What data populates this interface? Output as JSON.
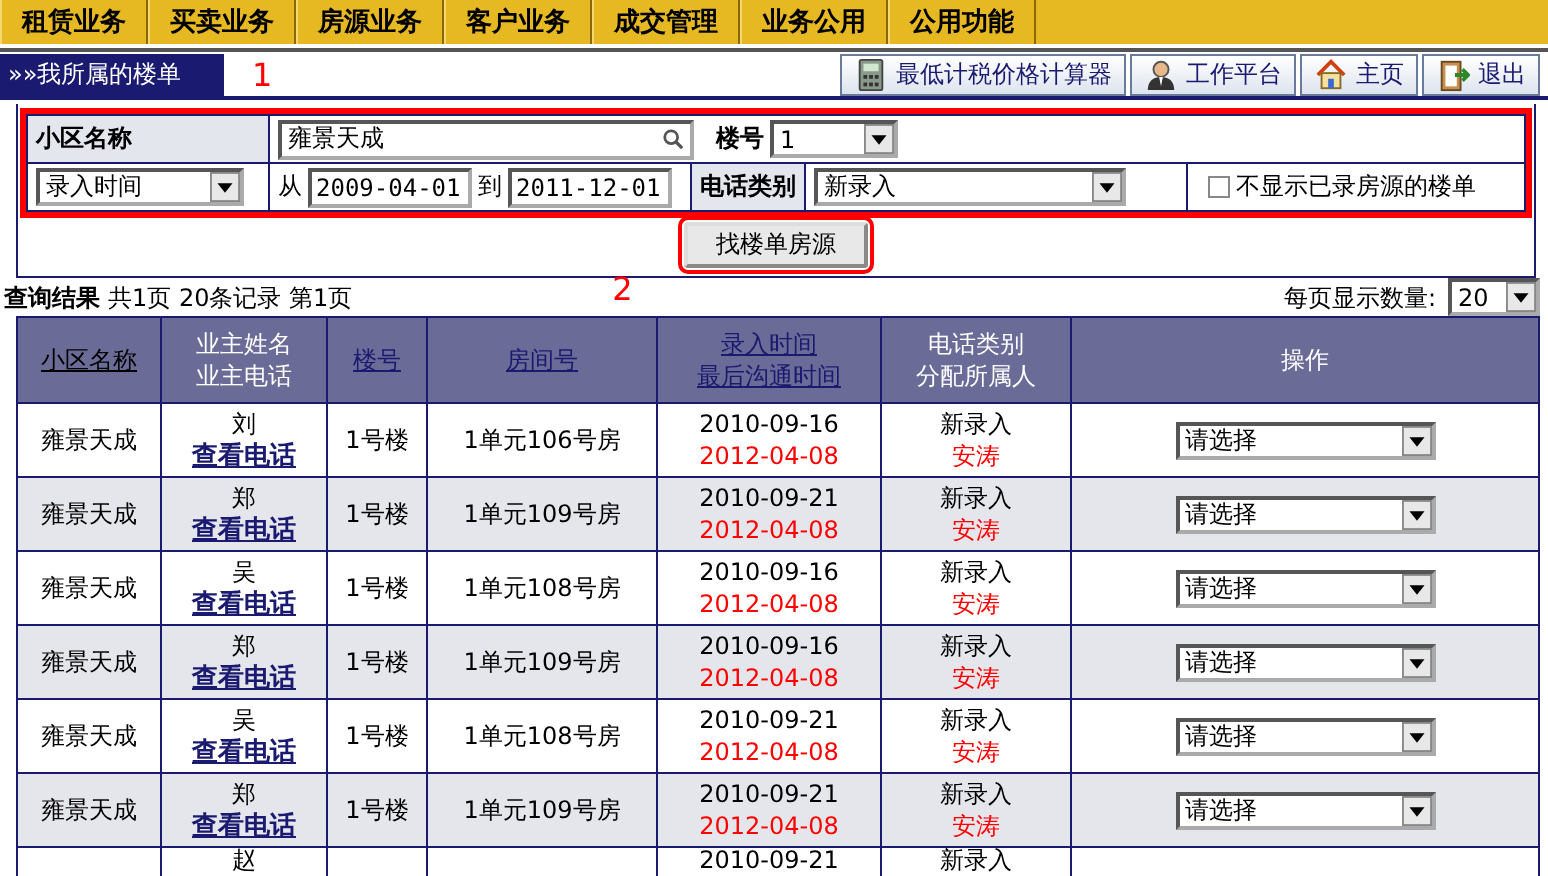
{
  "nav": [
    "租赁业务",
    "买卖业务",
    "房源业务",
    "客户业务",
    "成交管理",
    "业务公用",
    "公用功能"
  ],
  "title_bar": {
    "title": "»»我所属的楼单",
    "marker": "1"
  },
  "toolbar": [
    {
      "label": "最低计税价格计算器",
      "kind": "calculator"
    },
    {
      "label": "工作平台",
      "kind": "person"
    },
    {
      "label": "主页",
      "kind": "home"
    },
    {
      "label": "退出",
      "kind": "exit"
    }
  ],
  "form": {
    "community_label": "小区名称",
    "community": "雍景天成",
    "building_label": "楼号",
    "building": "1",
    "time_type": "录入时间",
    "from_label": "从",
    "from_date": "2009-04-01",
    "to_label": "到",
    "to_date": "2011-12-01",
    "phone_type_label": "电话类别",
    "phone_type": "新录入",
    "hide_recorded": {
      "label": "不显示已录房源的楼单",
      "checked": false
    },
    "search_button": "找楼单房源"
  },
  "results": {
    "heading": "查询结果",
    "summary": "共1页 20条记录 第1页",
    "marker": "2",
    "page_size_label": "每页显示数量:",
    "page_size": "20"
  },
  "table": {
    "columns": [
      {
        "lines": [
          "小区名称"
        ],
        "link": true
      },
      {
        "lines": [
          "业主姓名",
          "业主电话"
        ],
        "link": false
      },
      {
        "lines": [
          "楼号"
        ],
        "link": true
      },
      {
        "lines": [
          "房间号"
        ],
        "link": true
      },
      {
        "lines": [
          "录入时间",
          "最后沟通时间"
        ],
        "link": true
      },
      {
        "lines": [
          "电话类别",
          "分配所属人"
        ],
        "link": false
      },
      {
        "lines": [
          "操作"
        ],
        "link": false
      }
    ],
    "rows": [
      {
        "community": "雍景天成",
        "owner": "刘",
        "phone_link": "查看电话",
        "building": "1号楼",
        "room": "1单元106号房",
        "entry_date": "2010-09-16",
        "last_contact": "2012-04-08",
        "phone_type": "新录入",
        "assignee": "安涛",
        "action": "请选择"
      },
      {
        "community": "雍景天成",
        "owner": "郑",
        "phone_link": "查看电话",
        "building": "1号楼",
        "room": "1单元109号房",
        "entry_date": "2010-09-21",
        "last_contact": "2012-04-08",
        "phone_type": "新录入",
        "assignee": "安涛",
        "action": "请选择"
      },
      {
        "community": "雍景天成",
        "owner": "吴",
        "phone_link": "查看电话",
        "building": "1号楼",
        "room": "1单元108号房",
        "entry_date": "2010-09-16",
        "last_contact": "2012-04-08",
        "phone_type": "新录入",
        "assignee": "安涛",
        "action": "请选择"
      },
      {
        "community": "雍景天成",
        "owner": "郑",
        "phone_link": "查看电话",
        "building": "1号楼",
        "room": "1单元109号房",
        "entry_date": "2010-09-16",
        "last_contact": "2012-04-08",
        "phone_type": "新录入",
        "assignee": "安涛",
        "action": "请选择"
      },
      {
        "community": "雍景天成",
        "owner": "吴",
        "phone_link": "查看电话",
        "building": "1号楼",
        "room": "1单元108号房",
        "entry_date": "2010-09-21",
        "last_contact": "2012-04-08",
        "phone_type": "新录入",
        "assignee": "安涛",
        "action": "请选择"
      },
      {
        "community": "雍景天成",
        "owner": "郑",
        "phone_link": "查看电话",
        "building": "1号楼",
        "room": "1单元109号房",
        "entry_date": "2010-09-21",
        "last_contact": "2012-04-08",
        "phone_type": "新录入",
        "assignee": "安涛",
        "action": "请选择"
      }
    ],
    "partial_row": {
      "owner": "赵",
      "entry_date": "2010-09-21",
      "phone_type": "新录入"
    }
  }
}
